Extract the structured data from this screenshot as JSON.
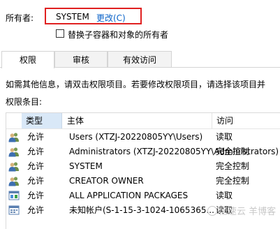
{
  "owner": {
    "label": "所有者:",
    "value": "SYSTEM",
    "change_link": "更改(C)"
  },
  "replace_owner_checkbox": {
    "label": "替换子容器和对象的所有者",
    "checked": false
  },
  "tabs": [
    {
      "label": "权限",
      "active": true
    },
    {
      "label": "审核",
      "active": false
    },
    {
      "label": "有效访问",
      "active": false
    }
  ],
  "info_text": "如需其他信息，请双击权限项目。若要修改权限项目，请选择该项目并",
  "entries_label": "权限条目:",
  "table": {
    "headers": [
      "类型",
      "主体",
      "访问"
    ],
    "rows": [
      {
        "type": "允许",
        "principal": "Users (XTZJ-20220805YY\\Users)",
        "access": "读取",
        "icon": "user-group-icon"
      },
      {
        "type": "允许",
        "principal": "Administrators (XTZJ-20220805YY\\Administrators)",
        "access": "完全控制",
        "icon": "user-group-icon"
      },
      {
        "type": "允许",
        "principal": "SYSTEM",
        "access": "完全控制",
        "icon": "user-group-icon"
      },
      {
        "type": "允许",
        "principal": "CREATOR OWNER",
        "access": "完全控制",
        "icon": "user-group-icon"
      },
      {
        "type": "允许",
        "principal": "ALL APPLICATION PACKAGES",
        "access": "读取",
        "icon": "app-package-icon"
      },
      {
        "type": "允许",
        "principal": "未知帐户(S-1-15-3-1024-1065365...",
        "access": "读取",
        "icon": "unknown-account-icon"
      }
    ]
  },
  "watermark": "亿速云 羊博客"
}
